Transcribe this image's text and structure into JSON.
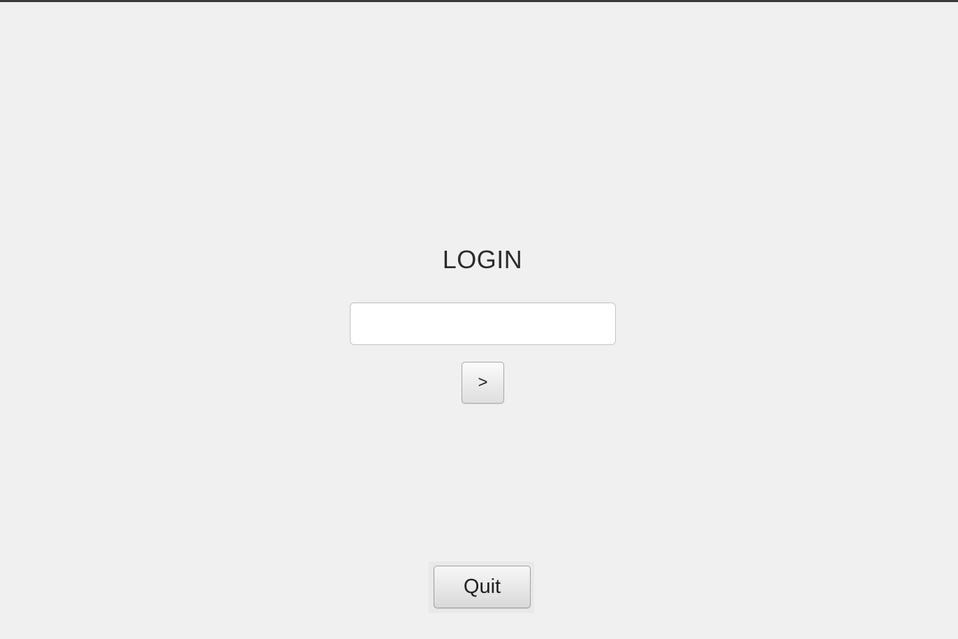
{
  "login": {
    "title": "LOGIN",
    "input_value": "",
    "input_placeholder": "",
    "submit_label": ">"
  },
  "footer": {
    "quit_label": "Quit"
  },
  "colors": {
    "background": "#f0f0f0",
    "text": "#2b2b2b",
    "input_background": "#ffffff",
    "button_border": "#a8a8a8"
  }
}
